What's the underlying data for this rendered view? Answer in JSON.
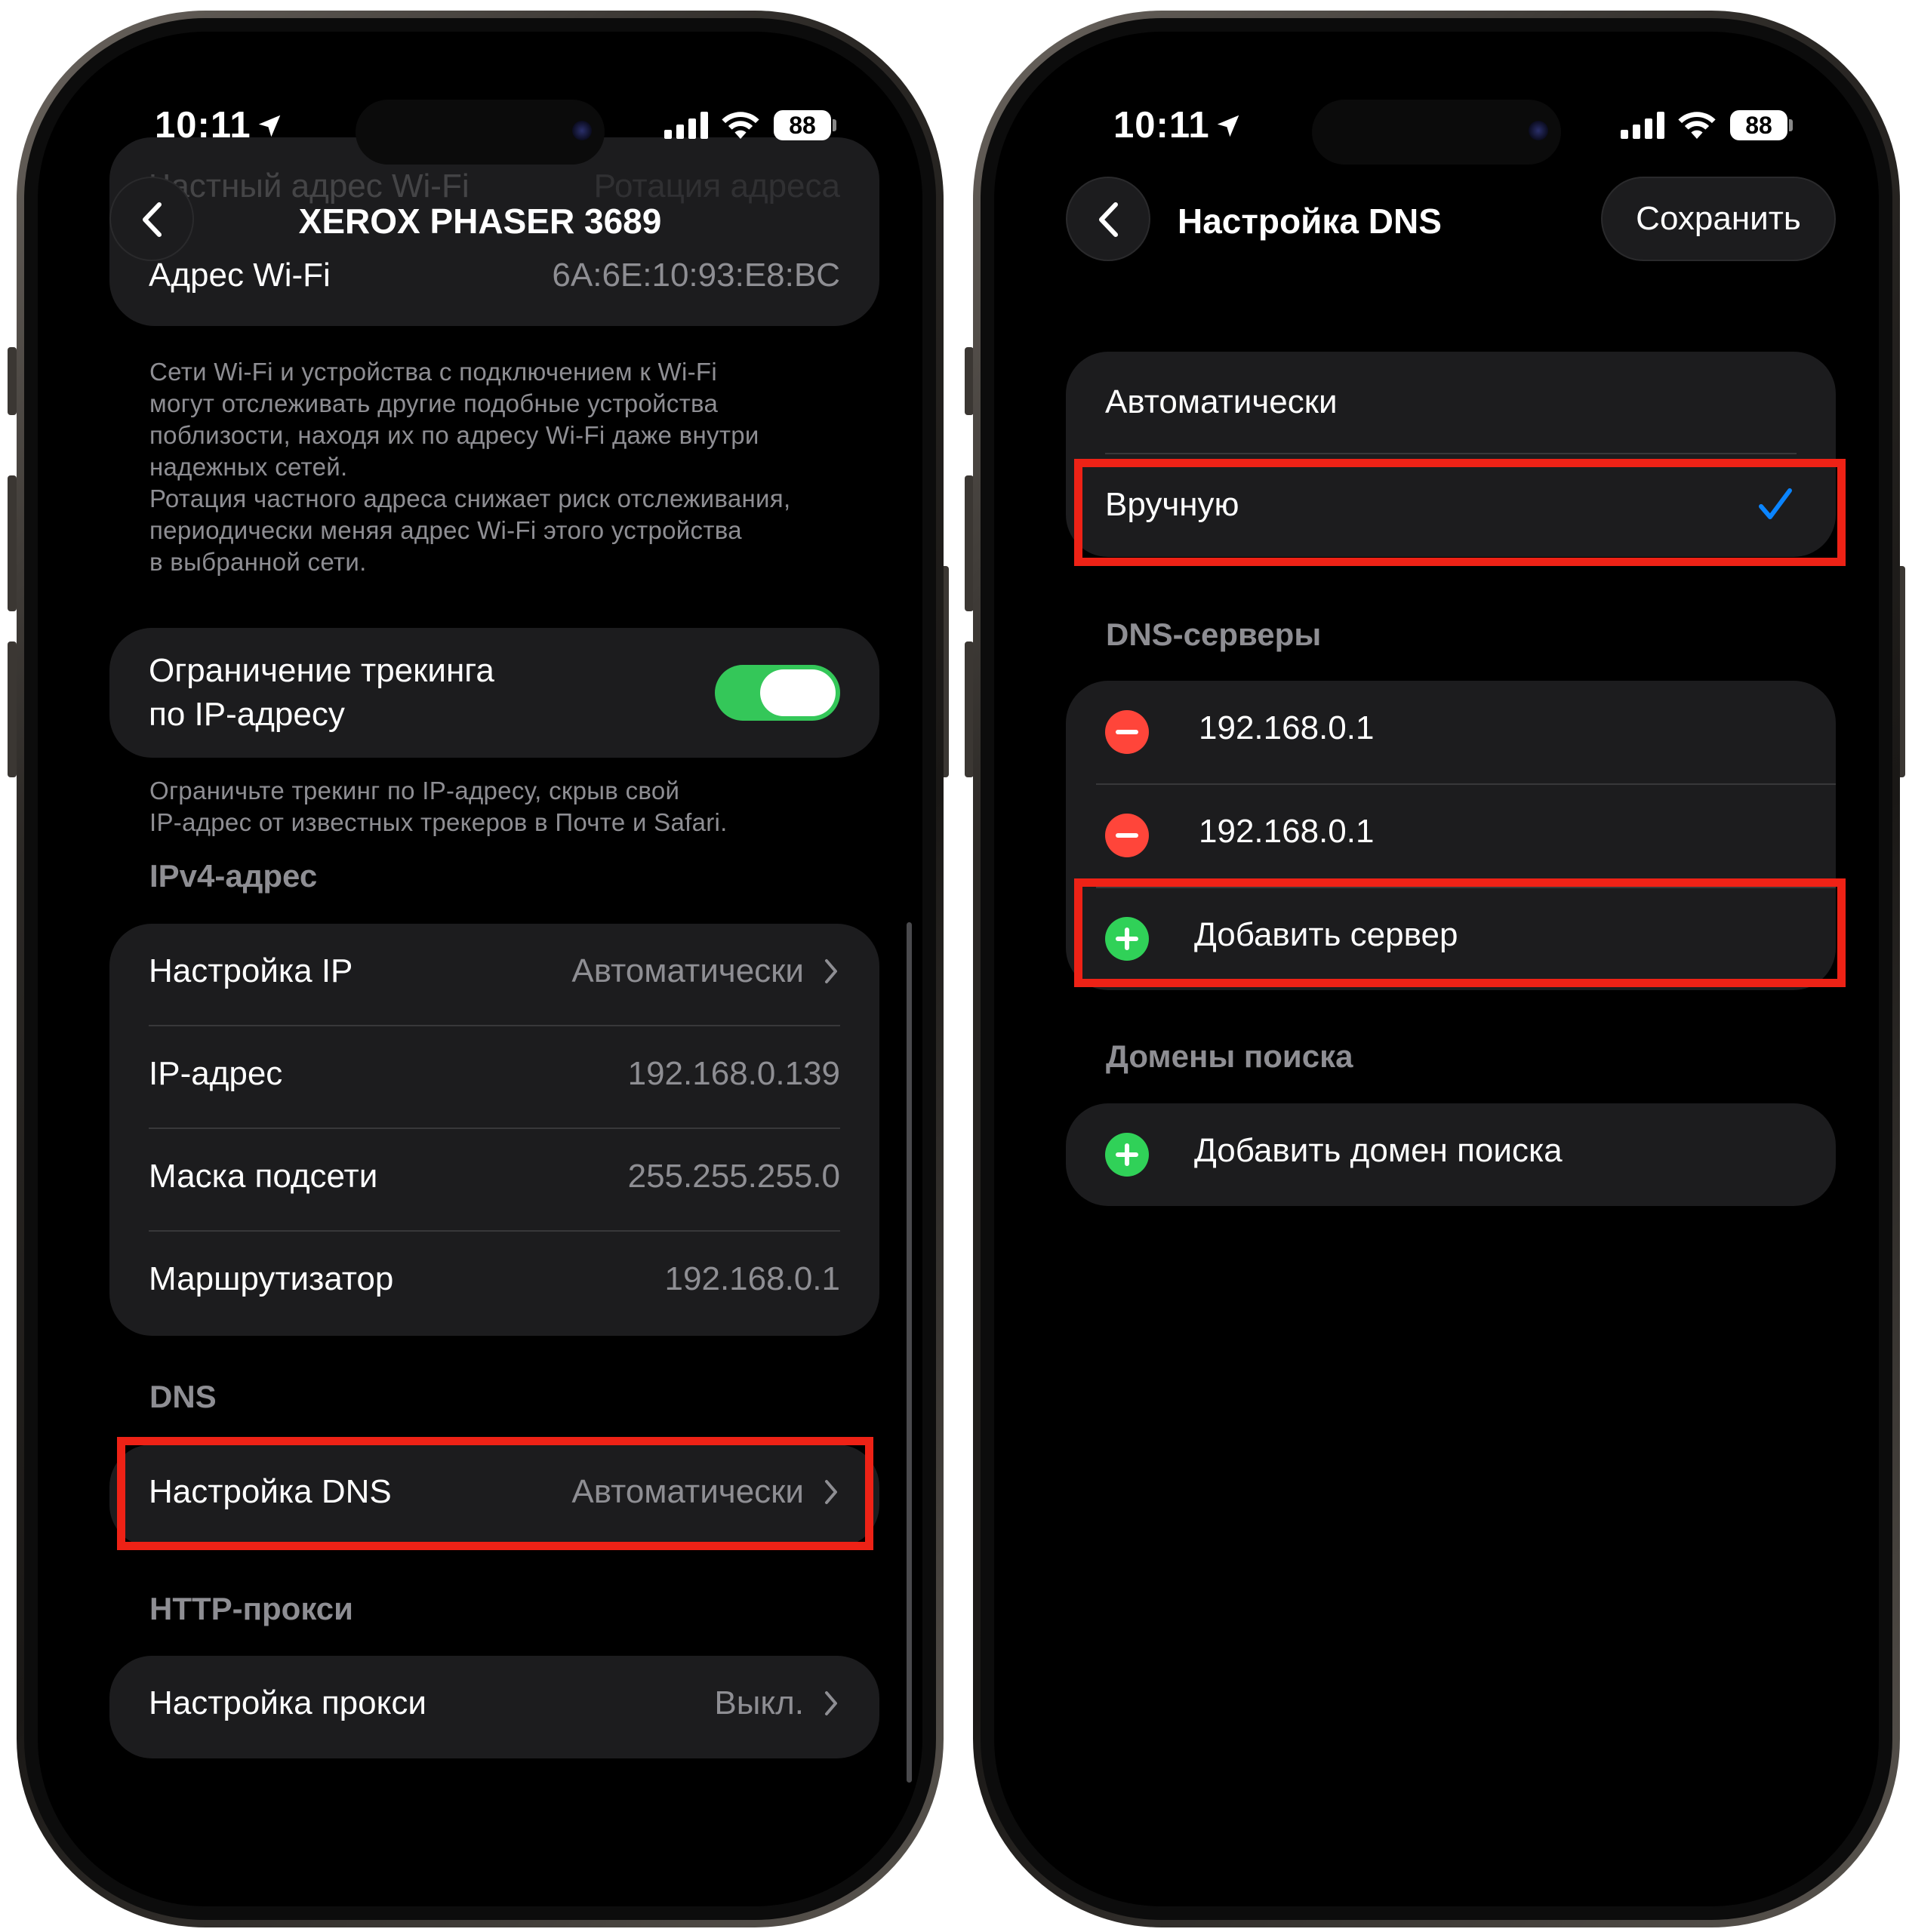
{
  "status_bar": {
    "time": "10:11",
    "battery": "88"
  },
  "left": {
    "nav_title": "XEROX PHASER 3689",
    "faded_row": {
      "label": "Частный адрес Wi-Fi",
      "value": "Ротация адреса"
    },
    "wifi_address": {
      "label": "Адрес Wi-Fi",
      "value": "6A:6E:10:93:E8:BC"
    },
    "wifi_note": [
      "Сети Wi-Fi и устройства с подключением к Wi-Fi",
      "могут отслеживать другие подобные устройства",
      "поблизости, находя их по адресу Wi-Fi даже внутри",
      "надежных сетей.",
      "Ротация частного адреса снижает риск отслеживания,",
      "периодически меняя адрес Wi-Fi этого устройства",
      "в выбранной сети."
    ],
    "tracking": {
      "line1": "Ограничение трекинга",
      "line2": "по IP-адресу",
      "enabled": true
    },
    "tracking_note": [
      "Ограничьте трекинг по IP-адресу, скрыв свой",
      "IP-адрес от известных трекеров в Почте и Safari."
    ],
    "ipv4_header": "IPv4-адрес",
    "ipv4_rows": [
      {
        "label": "Настройка IP",
        "value": "Автоматически"
      },
      {
        "label": "IP-адрес",
        "value": "192.168.0.139"
      },
      {
        "label": "Маска подсети",
        "value": "255.255.255.0"
      },
      {
        "label": "Маршрутизатор",
        "value": "192.168.0.1"
      }
    ],
    "dns_header": "DNS",
    "dns_row": {
      "label": "Настройка DNS",
      "value": "Автоматически"
    },
    "proxy_header": "HTTP-прокси",
    "proxy_row": {
      "label": "Настройка прокси",
      "value": "Выкл."
    }
  },
  "right": {
    "nav_title": "Настройка DNS",
    "save_label": "Сохранить",
    "modes": [
      {
        "label": "Автоматически"
      },
      {
        "label": "Вручную",
        "selected": true
      }
    ],
    "servers_header": "DNS-серверы",
    "servers": [
      "192.168.0.1",
      "192.168.0.1"
    ],
    "add_server": "Добавить сервер",
    "domains_header": "Домены поиска",
    "add_domain": "Добавить домен поиска"
  },
  "colors": {
    "highlight": "#ee2216",
    "toggle_on": "#34c759",
    "minus": "#ff453a",
    "plus": "#30d158",
    "checkmark": "#0a84ff"
  }
}
